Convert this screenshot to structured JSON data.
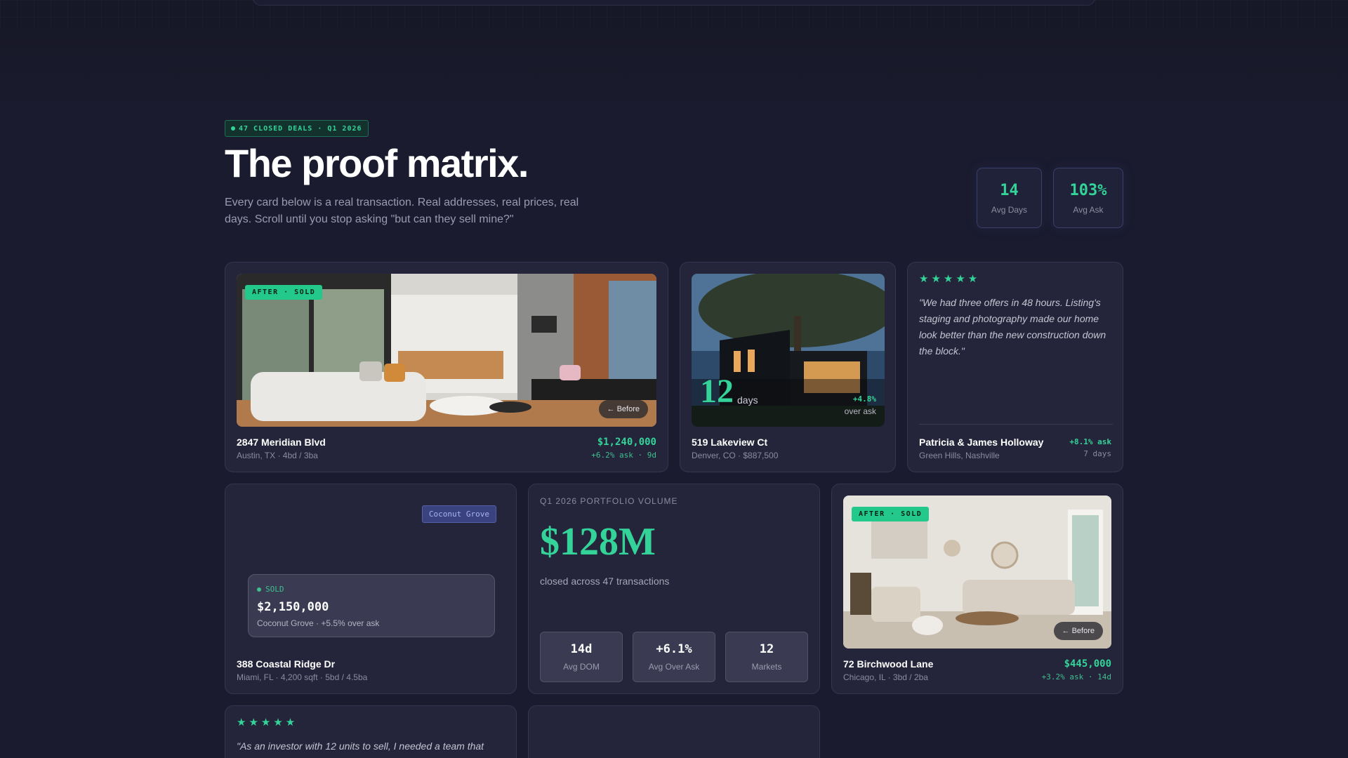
{
  "header": {
    "badge": "47 CLOSED DEALS · Q1 2026",
    "title": "The proof matrix.",
    "subtitle": "Every card below is a real transaction. Real addresses, real prices, real days. Scroll until you stop asking \"but can they sell mine?\"",
    "stats": [
      {
        "value": "14",
        "label": "Avg Days"
      },
      {
        "value": "103%",
        "label": "Avg Ask"
      }
    ]
  },
  "cards": {
    "meridian": {
      "tag": "AFTER · SOLD",
      "before": "← Before",
      "address": "2847 Meridian Blvd",
      "meta": "Austin, TX · 4bd / 3ba",
      "price": "$1,240,000",
      "delta": "+6.2% ask · 9d"
    },
    "lakeview": {
      "days": "12",
      "days_label": "days",
      "over": "+4.8%",
      "over_label": "over ask",
      "address": "519 Lakeview Ct",
      "meta": "Denver, CO · $887,500"
    },
    "testimonial_holloway": {
      "stars": "★★★★★",
      "quote": "\"We had three offers in 48 hours. Listing's staging and photography made our home look better than the new construction down the block.\"",
      "name": "Patricia & James Holloway",
      "location": "Green Hills, Nashville",
      "over": "+8.1% ask",
      "days": "7 days"
    },
    "coastal": {
      "chip": "Coconut Grove",
      "sold_label": "SOLD",
      "sold_price": "$2,150,000",
      "sold_meta": "Coconut Grove · +5.5% over ask",
      "address": "388 Coastal Ridge Dr",
      "meta": "Miami, FL · 4,200 sqft · 5bd / 4.5ba"
    },
    "volume": {
      "label": "Q1 2026 PORTFOLIO VOLUME",
      "amount": "$128M",
      "caption": "closed across 47 transactions",
      "stats": [
        {
          "value": "14d",
          "label": "Avg DOM"
        },
        {
          "value": "+6.1%",
          "label": "Avg Over Ask"
        },
        {
          "value": "12",
          "label": "Markets"
        }
      ]
    },
    "birchwood": {
      "tag": "AFTER · SOLD",
      "before": "← Before",
      "address": "72 Birchwood Lane",
      "meta": "Chicago, IL · 3bd / 2ba",
      "price": "$445,000",
      "delta": "+3.2% ask · 14d"
    },
    "testimonial_investor": {
      "stars": "★★★★★",
      "quote": "\"As an investor with 12 units to sell, I needed a team that"
    }
  }
}
